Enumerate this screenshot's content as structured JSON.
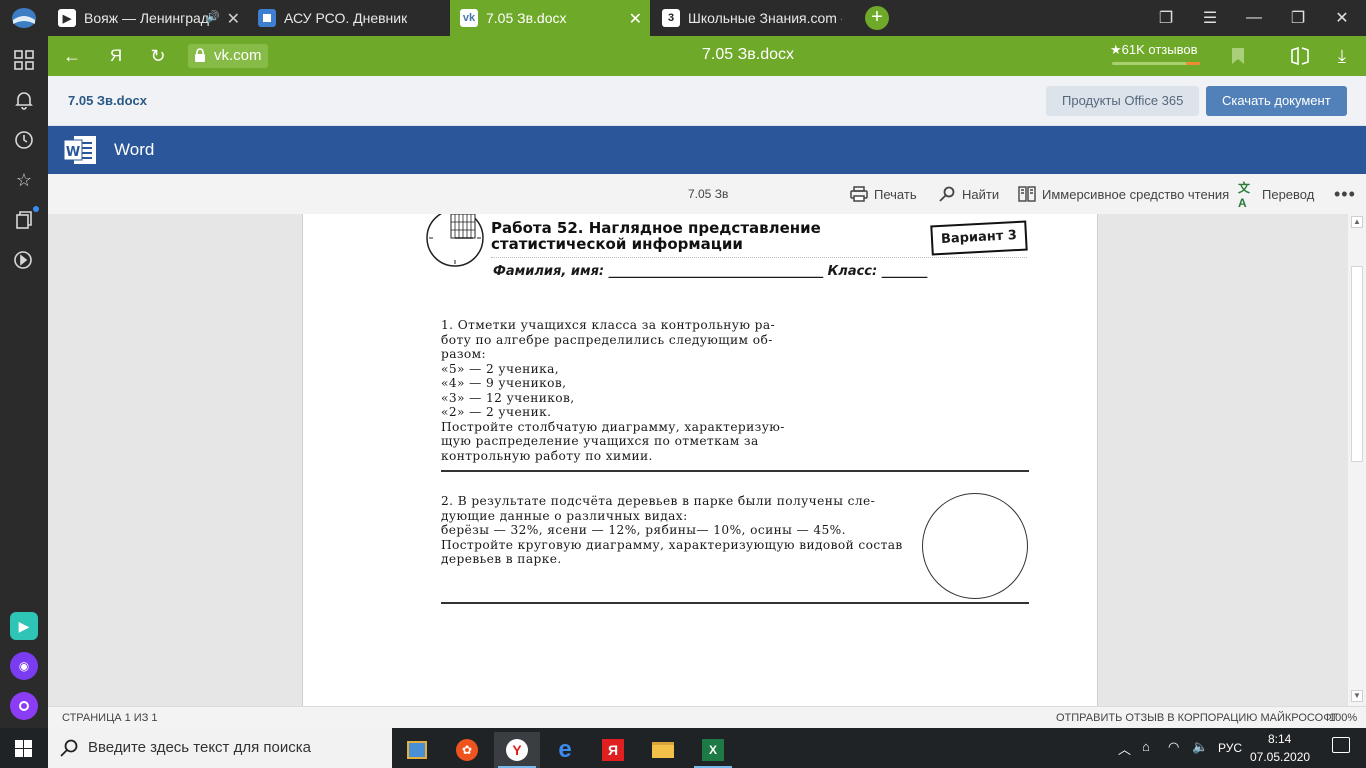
{
  "browser": {
    "tabs": [
      {
        "title": "Вояж — Ленинград",
        "icon": "play-icon",
        "active": false
      },
      {
        "title": "АСУ РСО. Дневник",
        "icon": "grid-favicon",
        "active": false
      },
      {
        "title": "7.05 Зв.docx",
        "icon": "vk-favicon",
        "active": true
      },
      {
        "title": "Школьные Знания.com - Р",
        "icon": "znanija-favicon",
        "active": false
      }
    ],
    "url": "vk.com",
    "page_title": "7.05 Зв.docx",
    "reviews": "★61K отзывов",
    "accent": "#6fa929"
  },
  "vk": {
    "doc_name": "7.05 Зв.docx",
    "office_button": "Продукты Office 365",
    "download_button": "Скачать документ"
  },
  "word": {
    "app_name": "Word",
    "doc_short_name": "7.05 Зв",
    "print": "Печать",
    "find": "Найти",
    "immersive_reader": "Иммерсивное средство чтения",
    "translate": "Перевод",
    "brand_color": "#2b579a"
  },
  "document": {
    "heading_line1": "Работа 52. Наглядное представление",
    "heading_line2": "статистической информации",
    "variant": "Вариант 3",
    "name_field": "Фамилия, имя: _________________________________   Класс: _______",
    "task1_lines": [
      "1.  Отметки учащихся класса за контрольную ра-",
      "боту по алгебре распределились следующим об-",
      "разом:",
      "«5» — 2 ученика,",
      "«4» — 9 учеников,",
      "«3» — 12 учеников,",
      "«2» — 2 ученик.",
      "Постройте столбчатую диаграмму, характеризую-",
      "щую распределение учащихся по отметкам за",
      "контрольную работу по химии."
    ],
    "task2_lines": [
      "2.  В результате подсчёта деревьев в парке были получены сле-",
      "дующие данные о различных видах:",
      "берёзы — 32%, ясени — 12%, рябины— 10%, осины — 45%.",
      "Постройте круговую диаграмму, характеризующую видовой состав",
      "деревьев в парке."
    ]
  },
  "status": {
    "page": "СТРАНИЦА 1 ИЗ 1",
    "feedback": "ОТПРАВИТЬ ОТЗЫВ В КОРПОРАЦИЮ МАЙКРОСОФТ",
    "zoom": "100%"
  },
  "taskbar": {
    "search_placeholder": "Введите здесь текст для поиска",
    "lang": "РУС",
    "time": "8:14",
    "date": "07.05.2020"
  }
}
